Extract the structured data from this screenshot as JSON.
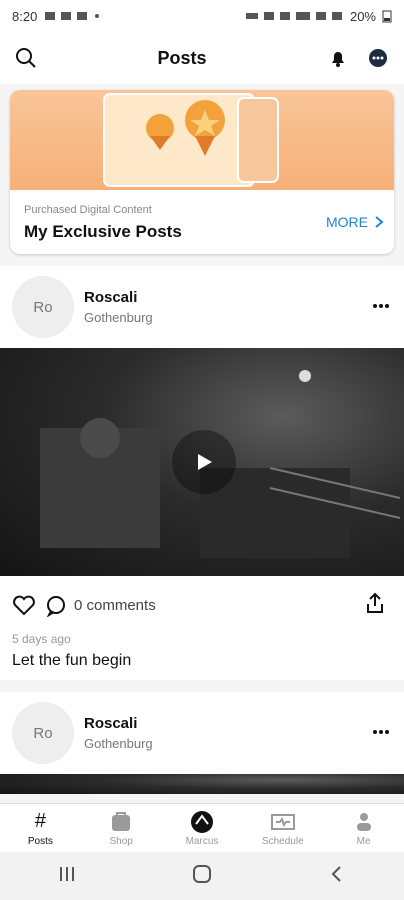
{
  "status": {
    "time": "8:20",
    "battery_text": "20%"
  },
  "header": {
    "title": "Posts"
  },
  "exclusive_card": {
    "subtitle": "Purchased Digital Content",
    "title": "My Exclusive Posts",
    "more_label": "MORE"
  },
  "posts": [
    {
      "avatar_initials": "Ro",
      "author": "Roscali",
      "location": "Gothenburg",
      "comments_label": "0 comments",
      "time_ago": "5 days ago",
      "caption": "Let the fun begin"
    },
    {
      "avatar_initials": "Ro",
      "author": "Roscali",
      "location": "Gothenburg"
    }
  ],
  "tabs": [
    {
      "label": "Posts",
      "icon": "hash-icon",
      "active": true
    },
    {
      "label": "Shop",
      "icon": "shop-icon",
      "active": false
    },
    {
      "label": "Marcus",
      "icon": "profile-logo-icon",
      "active": false
    },
    {
      "label": "Schedule",
      "icon": "schedule-icon",
      "active": false
    },
    {
      "label": "Me",
      "icon": "person-icon",
      "active": false
    }
  ],
  "colors": {
    "accent": "#1d88c9",
    "banner": "#f7b078"
  }
}
